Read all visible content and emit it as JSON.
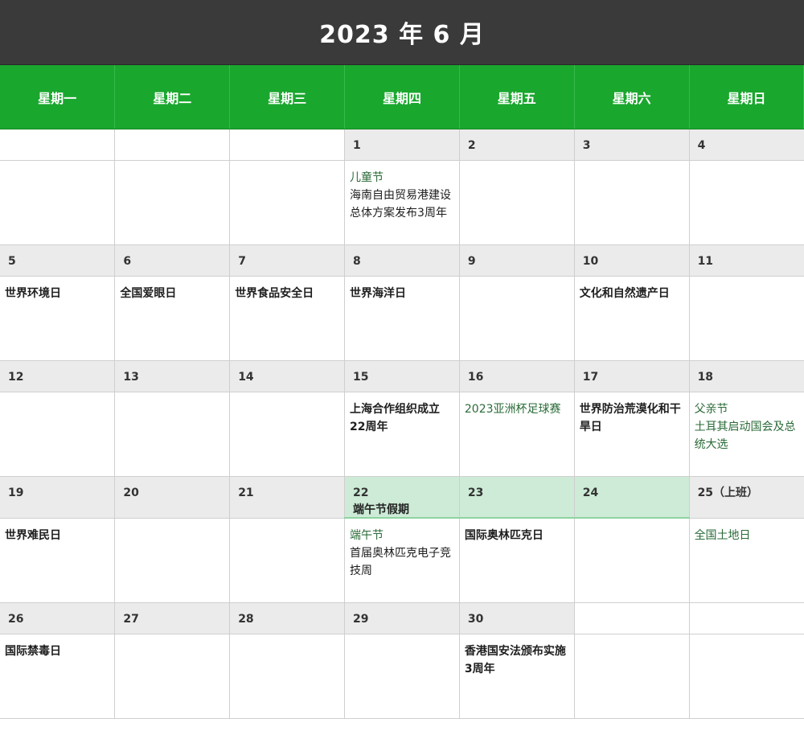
{
  "title": "2023 年 6 月",
  "weekdays": [
    "星期一",
    "星期二",
    "星期三",
    "星期四",
    "星期五",
    "星期六",
    "星期日"
  ],
  "weeks": [
    {
      "days": [
        "",
        "",
        "",
        "1",
        "2",
        "3",
        "4"
      ],
      "events": [
        [],
        [],
        [],
        [
          "儿童节",
          "海南自由贸易港建设总体方案发布3周年"
        ],
        [],
        [],
        []
      ]
    },
    {
      "days": [
        "5",
        "6",
        "7",
        "8",
        "9",
        "10",
        "11"
      ],
      "events": [
        [
          "世界环境日"
        ],
        [
          "全国爱眼日"
        ],
        [
          "世界食品安全日"
        ],
        [
          "世界海洋日"
        ],
        [],
        [
          "文化和自然遗产日"
        ],
        []
      ]
    },
    {
      "days": [
        "12",
        "13",
        "14",
        "15",
        "16",
        "17",
        "18"
      ],
      "events": [
        [],
        [],
        [],
        [
          "上海合作组织成立22周年"
        ],
        [
          "2023亚洲杯足球赛"
        ],
        [
          "世界防治荒漠化和干旱日"
        ],
        [
          "父亲节",
          "土耳其启动国会及总统大选"
        ]
      ]
    },
    {
      "days": [
        "19",
        "20",
        "21",
        "22",
        "23",
        "24",
        "25（上班）"
      ],
      "holiday_label": "端午节假期",
      "events": [
        [
          "世界难民日"
        ],
        [],
        [],
        [
          "端午节",
          "首届奥林匹克电子竞技周"
        ],
        [
          "国际奥林匹克日"
        ],
        [],
        [
          "全国土地日"
        ]
      ]
    },
    {
      "days": [
        "26",
        "27",
        "28",
        "29",
        "30",
        "",
        ""
      ],
      "events": [
        [
          "国际禁毒日"
        ],
        [],
        [],
        [],
        [
          "香港国安法颁布实施3周年"
        ],
        [],
        []
      ]
    }
  ],
  "colors": {
    "header_bg": "#3a3a3a",
    "weekday_bg": "#1aa72e",
    "holiday_bg": "#cdebd6"
  }
}
